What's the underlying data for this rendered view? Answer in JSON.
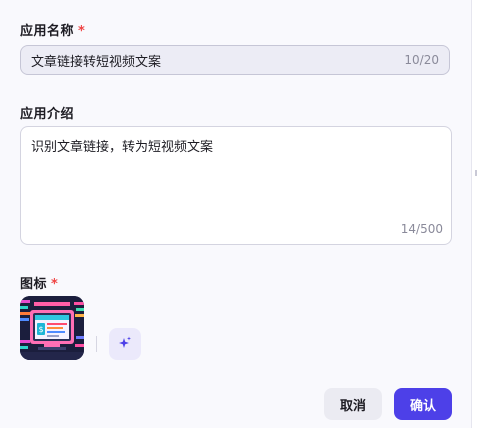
{
  "form": {
    "name_label": "应用名称",
    "name_required": "*",
    "name_value": "文章链接转短视频文案",
    "name_counter": "10/20",
    "desc_label": "应用介绍",
    "desc_value": "识别文章链接，转为短视频文案",
    "desc_counter": "14/500",
    "icon_label": "图标",
    "icon_required": "*"
  },
  "footer": {
    "cancel_label": "取消",
    "confirm_label": "确认"
  },
  "colors": {
    "primary": "#4d40e8",
    "required": "#ef4444",
    "ai_button_bg": "#ebe9fb"
  },
  "icons": {
    "app_icon": "app-thumbnail-icon",
    "ai_generate": "sparkle-icon"
  }
}
